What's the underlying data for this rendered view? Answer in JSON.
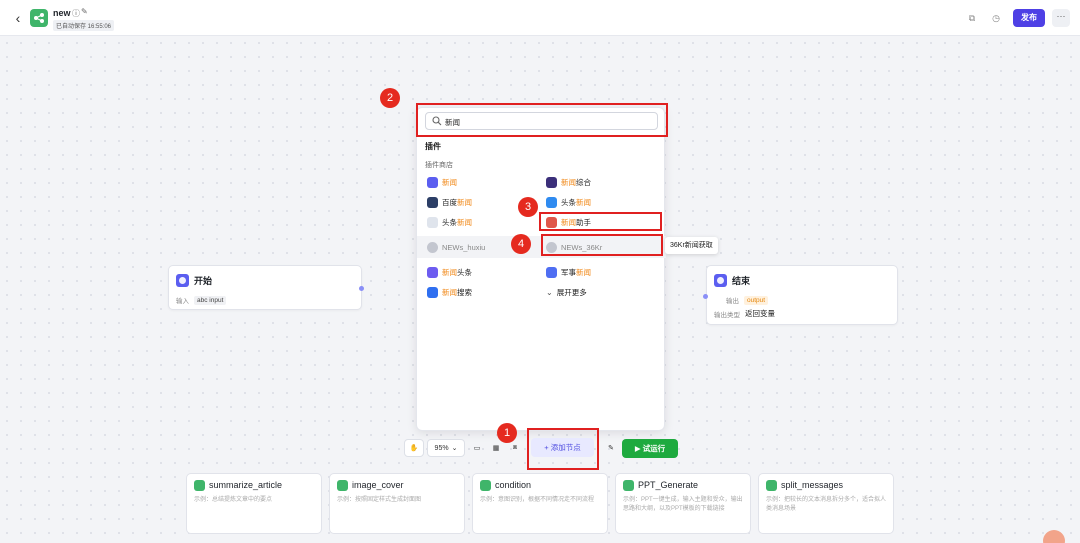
{
  "header": {
    "back_icon": "chevron-left-icon",
    "app_name": "new",
    "saved_status": "已自动保存 16:55:06",
    "publish_label": "发布",
    "more_label": "···"
  },
  "nodes": {
    "start": {
      "title": "开始",
      "input_label": "输入",
      "input_tag": "abc input"
    },
    "end": {
      "title": "结束",
      "output_label": "输出",
      "output_tag": "output",
      "output_type_label": "输出类型",
      "output_type_value": "返回变量"
    }
  },
  "search": {
    "value": "新闻"
  },
  "panel": {
    "section_title": "插件",
    "sub_title": "插件商店",
    "plugins": [
      {
        "pre": "",
        "hl": "新闻",
        "post": "",
        "color": "#5b5ef0"
      },
      {
        "pre": "",
        "hl": "新闻",
        "post": "综合",
        "color": "#3b2f7a"
      },
      {
        "pre": "百度",
        "hl": "新闻",
        "post": "",
        "color": "#2c3e66"
      },
      {
        "pre": "头条",
        "hl": "新闻",
        "post": "",
        "color": "#2f8bf0"
      },
      {
        "pre": "头条",
        "hl": "新闻",
        "post": "",
        "color": "#dfe4ec"
      },
      {
        "pre": "",
        "hl": "新闻",
        "post": "助手",
        "color": "#e0574a"
      },
      {
        "pre": "NEWs_huxiu",
        "hl": "",
        "post": "",
        "color": "#c3c6cf"
      },
      {
        "pre": "NEWs_36Kr",
        "hl": "",
        "post": "",
        "color": "#c3c6cf"
      },
      {
        "pre": "",
        "hl": "新闻",
        "post": "头条",
        "color": "#6d5cf0"
      },
      {
        "pre": "军事",
        "hl": "新闻",
        "post": "",
        "color": "#4f6ef2"
      },
      {
        "pre": "",
        "hl": "新闻",
        "post": "搜索",
        "color": "#2f6ff0"
      }
    ],
    "expand_label": "展开更多",
    "tooltip": "36Kr新闻获取"
  },
  "badges": [
    "1",
    "2",
    "3",
    "4"
  ],
  "toolbar": {
    "zoom": "95%",
    "add_node_label": "+ 添加节点",
    "run_label": "▶ 试运行"
  },
  "templates": [
    {
      "title": "summarize_article",
      "desc": "示例：总结提炼文章中的要点"
    },
    {
      "title": "image_cover",
      "desc": "示例：按照固定样式生成封面图"
    },
    {
      "title": "condition",
      "desc": "示例：意图识别，根据不同情况走不同流程"
    },
    {
      "title": "PPT_Generate",
      "desc": "示例：PPT一键生成，输入主题和受众，输出思路和大纲，以及PPT模板的下载链接"
    },
    {
      "title": "split_messages",
      "desc": "示例：把较长的文本消息拆分多个，适合拟人类消息场景"
    }
  ]
}
